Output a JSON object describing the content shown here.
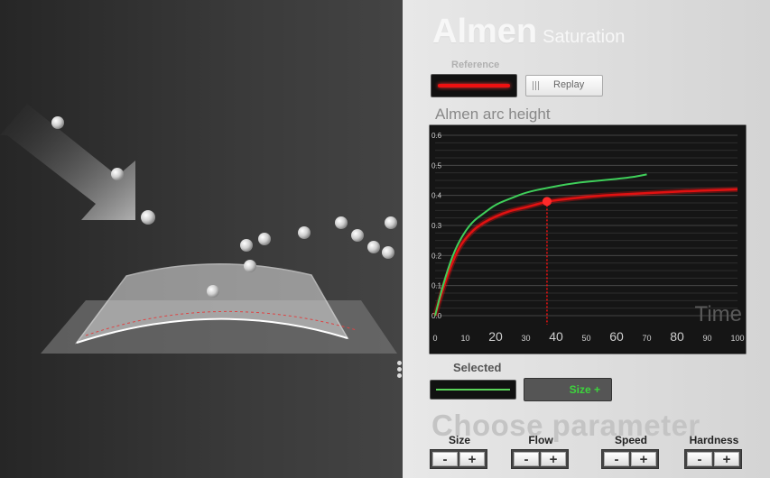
{
  "header": {
    "title": "Almen",
    "subtitle": "Saturation"
  },
  "reference": {
    "label": "Reference",
    "color": "#e11111",
    "replay_label": "Replay"
  },
  "chart_title": "Almen arc height",
  "chart_data": {
    "type": "line",
    "xlabel": "Time",
    "ylabel": "",
    "xlim": [
      0,
      100
    ],
    "ylim": [
      0,
      0.6
    ],
    "x_ticks": [
      "0",
      "10",
      "20",
      "30",
      "40",
      "50",
      "60",
      "70",
      "80",
      "90",
      "100"
    ],
    "y_ticks": [
      "0.0",
      "0.1",
      "0.2",
      "0.3",
      "0.4",
      "0.5",
      "0.6"
    ],
    "grid": true,
    "series": [
      {
        "color": "#e11111",
        "points": [
          [
            0,
            0
          ],
          [
            2,
            0.07
          ],
          [
            5,
            0.16
          ],
          [
            8,
            0.23
          ],
          [
            12,
            0.28
          ],
          [
            16,
            0.31
          ],
          [
            20,
            0.33
          ],
          [
            25,
            0.35
          ],
          [
            30,
            0.36
          ],
          [
            37,
            0.38
          ],
          [
            45,
            0.39
          ],
          [
            55,
            0.4
          ],
          [
            65,
            0.405
          ],
          [
            75,
            0.41
          ],
          [
            85,
            0.415
          ],
          [
            100,
            0.42
          ]
        ]
      },
      {
        "color": "#3fcf5a",
        "points": [
          [
            0,
            0
          ],
          [
            2,
            0.08
          ],
          [
            5,
            0.18
          ],
          [
            8,
            0.25
          ],
          [
            12,
            0.31
          ],
          [
            16,
            0.34
          ],
          [
            20,
            0.37
          ],
          [
            25,
            0.39
          ],
          [
            30,
            0.41
          ],
          [
            37,
            0.425
          ],
          [
            45,
            0.44
          ],
          [
            55,
            0.45
          ],
          [
            65,
            0.46
          ],
          [
            70,
            0.47
          ]
        ]
      }
    ],
    "marker": {
      "x": 37,
      "y": 0.38
    }
  },
  "selected": {
    "label": "Selected",
    "color": "#5ad35a",
    "param_label": "Size +"
  },
  "choose": {
    "title": "Choose parameter"
  },
  "params": [
    {
      "label": "Size",
      "minus": "-",
      "plus": "+"
    },
    {
      "label": "Flow",
      "minus": "-",
      "plus": "+"
    },
    {
      "label": "Speed",
      "minus": "-",
      "plus": "+"
    },
    {
      "label": "Hardness",
      "minus": "-",
      "plus": "+"
    }
  ]
}
